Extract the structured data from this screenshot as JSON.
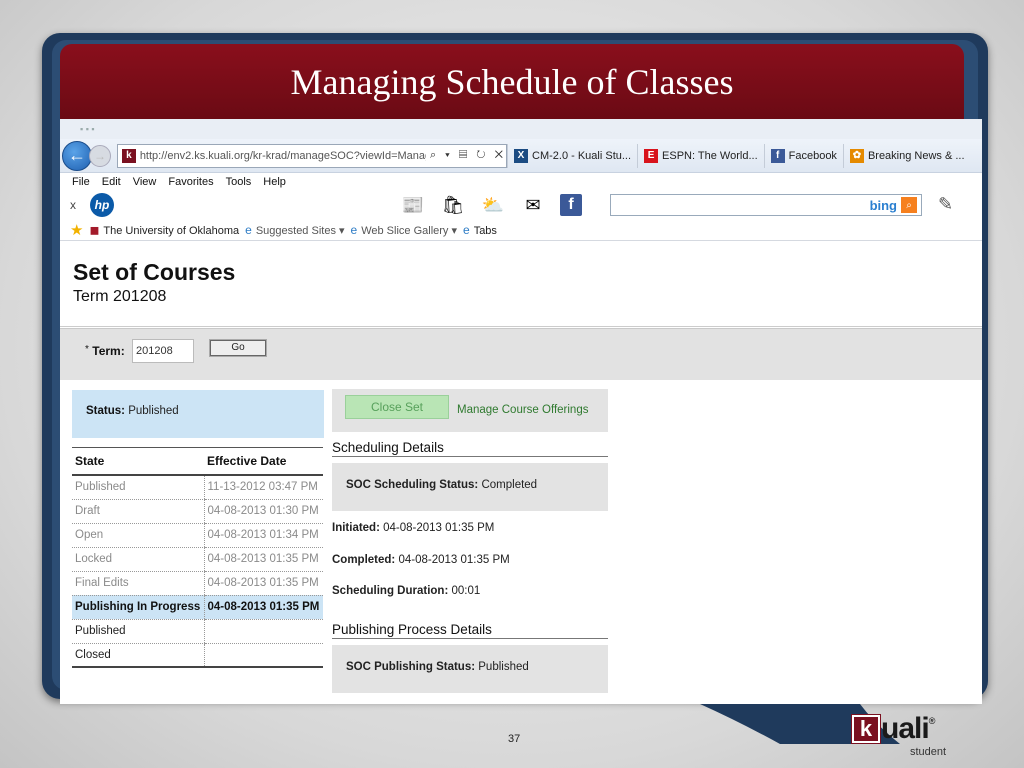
{
  "slide": {
    "title": "Managing Schedule of Classes",
    "page_number": "37",
    "brand": {
      "mark": "k",
      "word": "uali",
      "reg": "®",
      "sub": "student"
    }
  },
  "browser": {
    "url": "http://env2.ks.kuali.org/kr-krad/manageSOC?viewId=ManageS",
    "url_icons": "⌕ ▾ ▤ ↻ ✕",
    "tabs": [
      {
        "label": "CM-2.0 - Kuali Stu...",
        "icon": "X",
        "color": "#1b4b82"
      },
      {
        "label": "ESPN: The World...",
        "icon": "E",
        "color": "#d8131c"
      },
      {
        "label": "Facebook",
        "icon": "f",
        "color": "#3b5998"
      },
      {
        "label": "Breaking News & ...",
        "icon": "✿",
        "color": "#e58a00"
      }
    ],
    "menu": [
      "File",
      "Edit",
      "View",
      "Favorites",
      "Tools",
      "Help"
    ],
    "toolbar_close": "x",
    "hp_label": "hp",
    "search_brand": "bing",
    "favorites": [
      {
        "label": "The University of Oklahoma",
        "icon": "◼",
        "muted": false
      },
      {
        "label": "Suggested Sites ▾",
        "icon": "e",
        "muted": true
      },
      {
        "label": "Web Slice Gallery ▾",
        "icon": "e",
        "muted": true
      },
      {
        "label": "Tabs",
        "icon": "e",
        "muted": false
      }
    ]
  },
  "page": {
    "heading": "Set of Courses",
    "subheading": "Term 201208",
    "term_label": "Term:",
    "term_required": "*",
    "term_value": "201208",
    "go_label": "Go",
    "status_label": "Status:",
    "status_value": "Published",
    "close_set_label": "Close Set",
    "manage_link": "Manage Course Offerings",
    "table": {
      "headers": [
        "State",
        "Effective Date"
      ],
      "rows": [
        {
          "state": "Published",
          "date": "11-13-2012 03:47 PM",
          "kind": "past"
        },
        {
          "state": "Draft",
          "date": "04-08-2013 01:30 PM",
          "kind": "past"
        },
        {
          "state": "Open",
          "date": "04-08-2013 01:34 PM",
          "kind": "past"
        },
        {
          "state": "Locked",
          "date": "04-08-2013 01:35 PM",
          "kind": "past"
        },
        {
          "state": "Final Edits",
          "date": "04-08-2013 01:35 PM",
          "kind": "past"
        },
        {
          "state": "Publishing In Progress",
          "date": "04-08-2013 01:35 PM",
          "kind": "current"
        },
        {
          "state": "Published",
          "date": "",
          "kind": "future"
        },
        {
          "state": "Closed",
          "date": "",
          "kind": "future"
        }
      ]
    },
    "scheduling": {
      "title": "Scheduling Details",
      "status_label": "SOC Scheduling Status:",
      "status_value": "Completed",
      "initiated_label": "Initiated:",
      "initiated_value": "04-08-2013 01:35 PM",
      "completed_label": "Completed:",
      "completed_value": "04-08-2013 01:35 PM",
      "duration_label": "Scheduling Duration:",
      "duration_value": "00:01"
    },
    "publishing": {
      "title": "Publishing Process Details",
      "status_label": "SOC Publishing Status:",
      "status_value": "Published"
    }
  }
}
